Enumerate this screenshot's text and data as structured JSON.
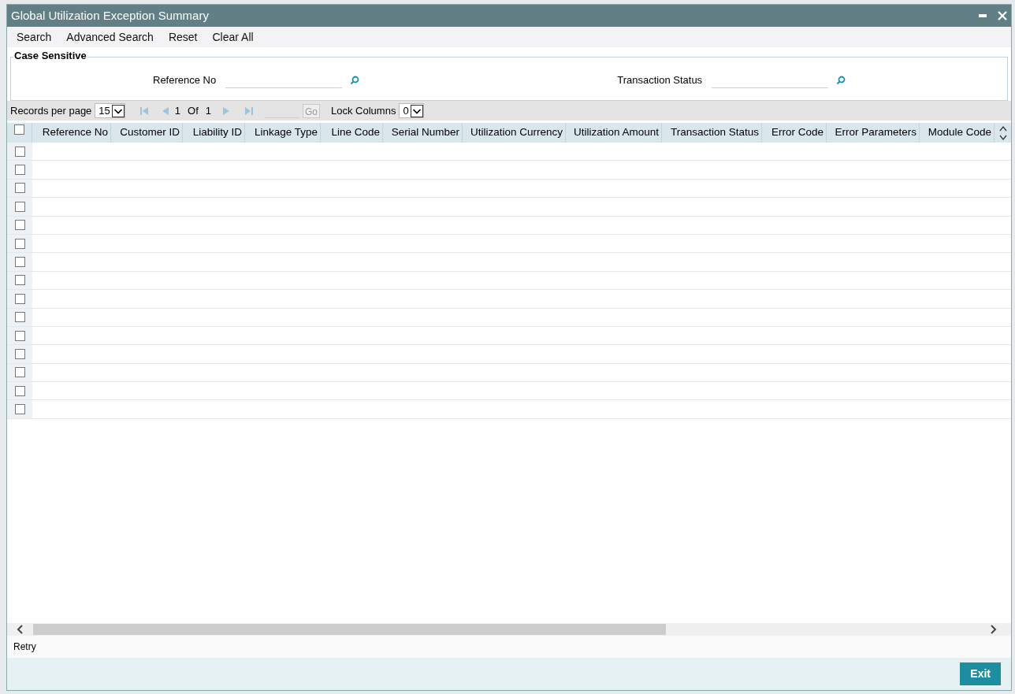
{
  "window": {
    "title": "Global Utilization Exception Summary"
  },
  "toolbar": [
    "Search",
    "Advanced Search",
    "Reset",
    "Clear All"
  ],
  "search_panel": {
    "legend": "Case Sensitive",
    "fields": [
      {
        "label": "Reference No"
      },
      {
        "label": "Transaction Status"
      }
    ]
  },
  "pagination": {
    "records_label": "Records per page",
    "records_per_page": "15",
    "page": "1",
    "of_label": "Of",
    "total_pages": "1",
    "go": "Go",
    "lock_label": "Lock Columns",
    "lock_columns": "0"
  },
  "table": {
    "select_all_checked": false,
    "columns": [
      "Reference No",
      "Customer ID",
      "Liability ID",
      "Linkage Type",
      "Line Code",
      "Serial Number",
      "Utilization Currency",
      "Utilization Amount",
      "Transaction Status",
      "Error Code",
      "Error Parameters",
      "Module Code"
    ],
    "rows": [
      {
        "checked": false
      },
      {
        "checked": false
      },
      {
        "checked": false
      },
      {
        "checked": false
      },
      {
        "checked": false
      },
      {
        "checked": false
      },
      {
        "checked": false
      },
      {
        "checked": false
      },
      {
        "checked": false
      },
      {
        "checked": false
      },
      {
        "checked": false
      },
      {
        "checked": false
      },
      {
        "checked": false
      },
      {
        "checked": false
      },
      {
        "checked": false
      }
    ]
  },
  "status_bar": {
    "action": "Retry"
  },
  "footer": {
    "button": "Exit"
  }
}
